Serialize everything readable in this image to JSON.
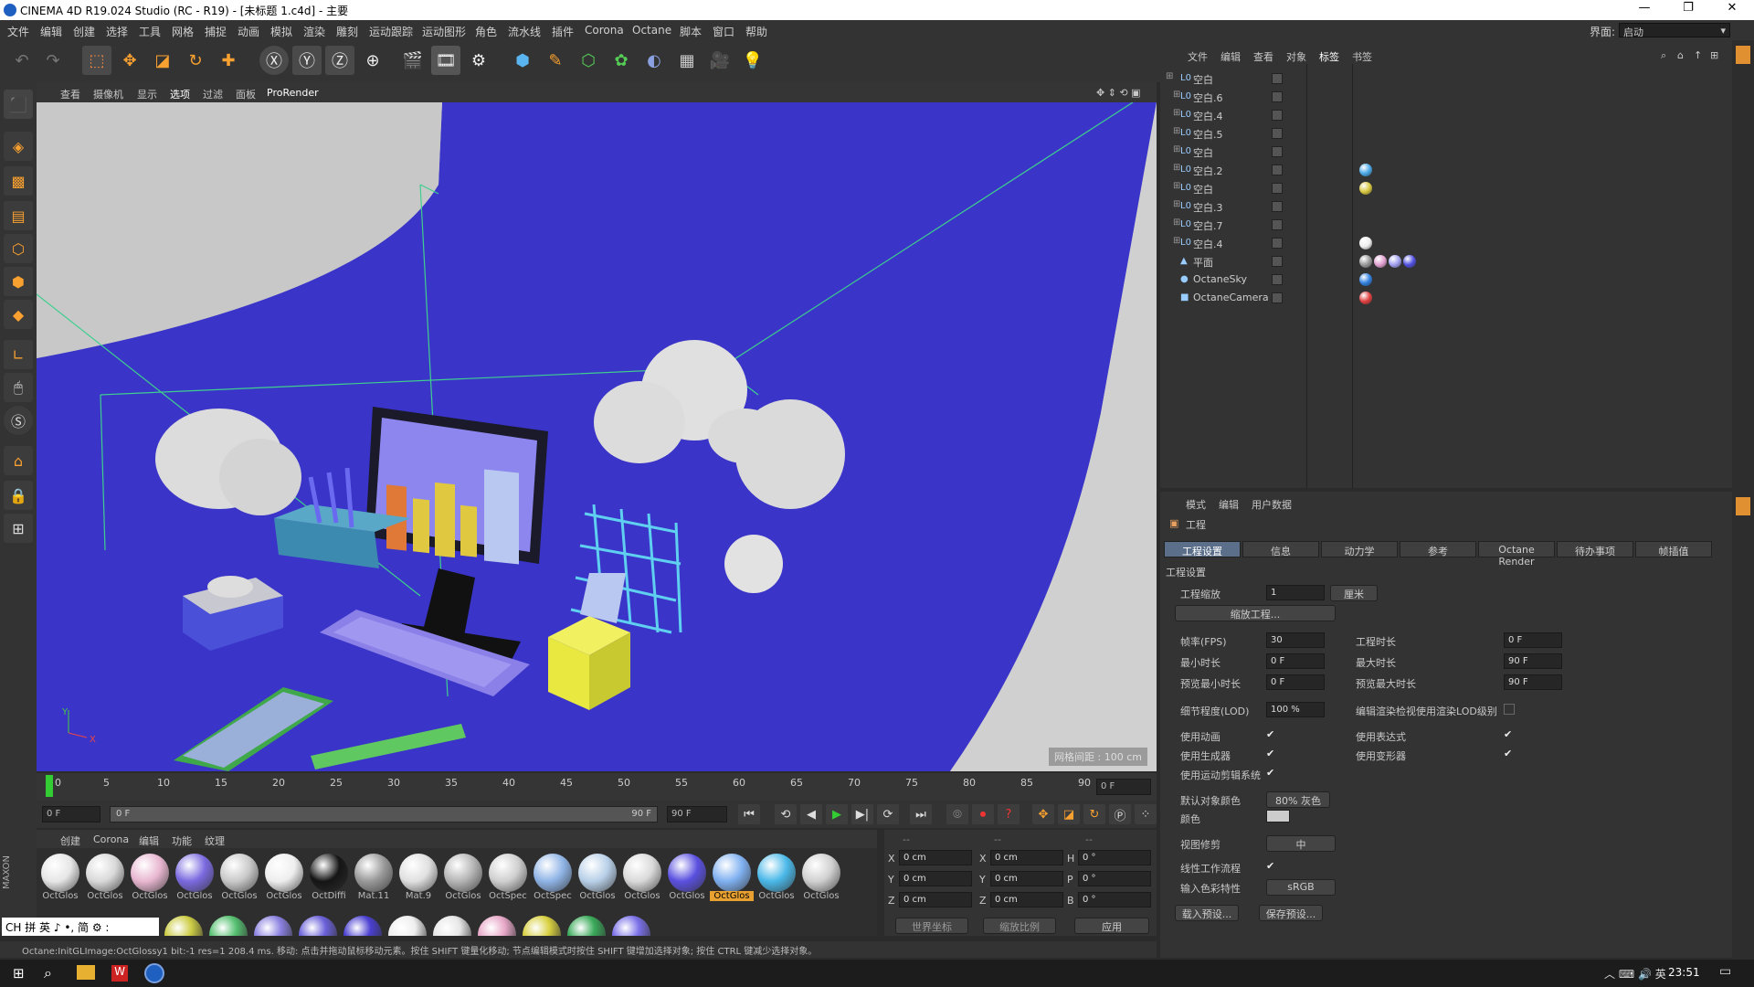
{
  "window": {
    "title": "CINEMA 4D R19.024 Studio (RC - R19) - [未标题 1.c4d] - 主要"
  },
  "menu": [
    "文件",
    "编辑",
    "创建",
    "选择",
    "工具",
    "网格",
    "捕捉",
    "动画",
    "模拟",
    "渲染",
    "雕刻",
    "运动跟踪",
    "运动图形",
    "角色",
    "流水线",
    "插件",
    "Corona",
    "Octane",
    "脚本",
    "窗口",
    "帮助"
  ],
  "layout": {
    "label": "界面:",
    "value": "启动"
  },
  "viewport_menu": [
    "查看",
    "摄像机",
    "显示",
    "选项",
    "过滤",
    "面板",
    "ProRender"
  ],
  "viewport": {
    "grid_label": "网格间距 : 100 cm"
  },
  "timeline": {
    "ticks": [
      "0",
      "5",
      "10",
      "15",
      "20",
      "25",
      "30",
      "35",
      "40",
      "45",
      "50",
      "55",
      "60",
      "65",
      "70",
      "75",
      "80",
      "85",
      "90"
    ],
    "frame_display": "0 F"
  },
  "transport": {
    "current": "0 F",
    "range_start": "0 F",
    "range_end": "90 F",
    "end": "90 F"
  },
  "materials": {
    "menu": [
      "创建",
      "Corona",
      "编辑",
      "功能",
      "纹理"
    ],
    "row1": [
      {
        "name": "OctGlos",
        "color": "#e6e6e6"
      },
      {
        "name": "OctGlos",
        "color": "#d9d9d9"
      },
      {
        "name": "OctGlos",
        "color": "#e8b6d0"
      },
      {
        "name": "OctGlos",
        "color": "#7a6ae0"
      },
      {
        "name": "OctGlos",
        "color": "#c9c9c9"
      },
      {
        "name": "OctGlos",
        "color": "#eeeeee"
      },
      {
        "name": "OctDiffi",
        "color": "#151515"
      },
      {
        "name": "Mat.11",
        "color": "#999999"
      },
      {
        "name": "Mat.9",
        "color": "#e0e0e0"
      },
      {
        "name": "OctGlos",
        "color": "#b5b5b5"
      },
      {
        "name": "OctSpec",
        "color": "#cfcfcf"
      },
      {
        "name": "OctSpec",
        "color": "#8fb4e6"
      },
      {
        "name": "OctGlos",
        "color": "#b8d0e8"
      },
      {
        "name": "OctGlos",
        "color": "#dadada"
      },
      {
        "name": "OctGlos",
        "color": "#5a50e0"
      },
      {
        "name": "OctGlos",
        "color": "#7fb0f0"
      },
      {
        "name": "OctGlos",
        "color": "#4ab8e8"
      },
      {
        "name": "OctGlos",
        "color": "#d0d0d0"
      }
    ],
    "row2": [
      "#cccc44",
      "#55c070",
      "#8a80e0",
      "#6a60d8",
      "#4a3fd0",
      "#eeeeee",
      "#e6e6e6",
      "#e8a8c8",
      "#d8d040",
      "#3aaa5a",
      "#7a70e8"
    ]
  },
  "coords": {
    "header": [
      "--",
      "--",
      "--"
    ],
    "rows": [
      {
        "a": "X",
        "av": "0 cm",
        "b": "X",
        "bv": "0 cm",
        "c": "H",
        "cv": "0 °"
      },
      {
        "a": "Y",
        "av": "0 cm",
        "b": "Y",
        "bv": "0 cm",
        "c": "P",
        "cv": "0 °"
      },
      {
        "a": "Z",
        "av": "0 cm",
        "b": "Z",
        "bv": "0 cm",
        "c": "B",
        "cv": "0 °"
      }
    ],
    "sel1": "世界坐标",
    "sel2": "缩放比例",
    "apply": "应用"
  },
  "ime": "CH 拼 英 ♪ •, 简 ⚙ :",
  "status": "Octane:InitGLImage:OctGlossy1  bit:-1 res=1  208.4 ms.   移动: 点击并拖动鼠标移动元素。按住 SHIFT 键量化移动; 节点编辑模式时按住 SHIFT 键增加选择对象; 按住 CTRL 键减少选择对象。",
  "objects": {
    "menu": [
      "文件",
      "编辑",
      "查看",
      "对象",
      "标签",
      "书签"
    ],
    "items": [
      {
        "name": "空白",
        "tags": []
      },
      {
        "name": "空白.6",
        "tags": []
      },
      {
        "name": "空白.4",
        "tags": []
      },
      {
        "name": "空白.5",
        "tags": []
      },
      {
        "name": "空白",
        "tags": []
      },
      {
        "name": "空白.2",
        "tags": [
          "#4aa8e8"
        ]
      },
      {
        "name": "空白",
        "tags": [
          "#d8c840"
        ]
      },
      {
        "name": "空白.3",
        "tags": []
      },
      {
        "name": "空白.7",
        "tags": []
      },
      {
        "name": "空白.4",
        "tags": [
          "#eeeeee"
        ]
      },
      {
        "name": "平面",
        "tags": [
          "#999999",
          "#e0a0d0",
          "#a0a0f0",
          "#5050e0"
        ]
      },
      {
        "name": "OctaneSky",
        "tags": [
          "#3080e0"
        ]
      },
      {
        "name": "OctaneCamera",
        "tags": [
          "#e04040"
        ]
      }
    ]
  },
  "attributes": {
    "menu": [
      "模式",
      "编辑",
      "用户数据"
    ],
    "title": "工程",
    "tabs": [
      "工程设置",
      "信息",
      "动力学",
      "参考",
      "Octane Render",
      "待办事项",
      "帧插值"
    ],
    "section": "工程设置",
    "scale_label": "工程缩放",
    "scale_value": "1",
    "scale_unit": "厘米",
    "scale_btn": "缩放工程...",
    "fps_label": "帧率(FPS)",
    "fps": "30",
    "min_label": "最小时长",
    "min": "0 F",
    "pmin_label": "预览最小时长",
    "pmin": "0 F",
    "dur_label": "工程时长",
    "dur": "0 F",
    "max_label": "最大时长",
    "max": "90 F",
    "pmax_label": "预览最大时长",
    "pmax": "90 F",
    "lod_label": "细节程度(LOD)",
    "lod": "100 %",
    "lod_render_label": "编辑渲染检视使用渲染LOD级别",
    "use_anim": "使用动画",
    "use_expr": "使用表达式",
    "use_gen": "使用生成器",
    "use_deform": "使用变形器",
    "use_mograph": "使用运动剪辑系统",
    "defcolor_label": "默认对象颜色",
    "defcolor": "80% 灰色",
    "color_label": "颜色",
    "clip_label": "视图修剪",
    "clip": "中",
    "linear_label": "线性工作流程",
    "profile_label": "输入色彩特性",
    "profile": "sRGB",
    "load_btn": "载入预设...",
    "save_btn": "保存预设..."
  },
  "taskbar": {
    "time": "23:51"
  }
}
